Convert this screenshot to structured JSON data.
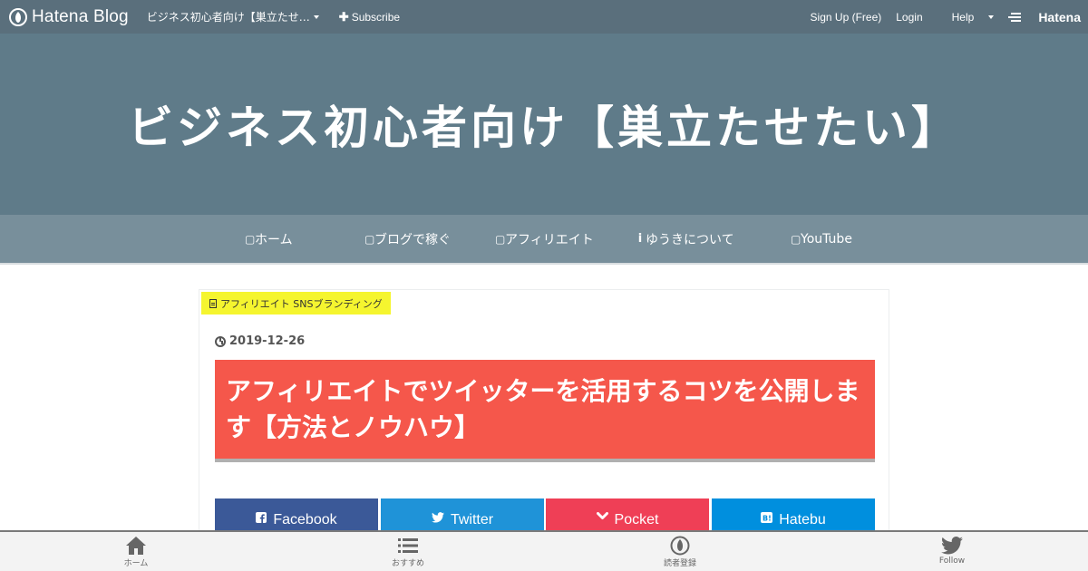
{
  "globalbar": {
    "logo_text": "Hatena Blog",
    "blog_name": "ビジネス初心者向け【巣立たせ…",
    "subscribe_label": "Subscribe",
    "signup_label": "Sign Up (Free)",
    "login_label": "Login",
    "help_label": "Help",
    "hatena_label": "Hatena"
  },
  "header": {
    "title": "ビジネス初心者向け【巣立たせたい】"
  },
  "nav": {
    "items": [
      {
        "label": "ホーム",
        "icon": "home-icon"
      },
      {
        "label": "ブログで稼ぐ",
        "icon": "pen-icon"
      },
      {
        "label": "アフィリエイト",
        "icon": "money-icon"
      },
      {
        "label": "ゆうきについて",
        "icon": "info-icon",
        "prefix": "i"
      },
      {
        "label": "YouTube",
        "icon": "youtube-icon"
      }
    ]
  },
  "article": {
    "category": "アフィリエイト SNSブランディング",
    "date": "2019-12-26",
    "title": "アフィリエイトでツイッターを活用するコツを公開します【方法とノウハウ】"
  },
  "share": {
    "facebook": "Facebook",
    "twitter": "Twitter",
    "pocket": "Pocket",
    "hatebu": "Hatebu"
  },
  "bottombar": {
    "home": "ホーム",
    "recommend": "おすすめ",
    "reader": "読者登録",
    "follow": "Follow"
  },
  "colors": {
    "globalbar": "#5a6f7c",
    "header": "#5f7b89",
    "nav": "#788f9b",
    "category": "#f5f52f",
    "title_bg": "#f5574b",
    "facebook": "#3b5998",
    "twitter": "#1f93d8",
    "pocket": "#ef3f56",
    "hatebu": "#008fde"
  }
}
